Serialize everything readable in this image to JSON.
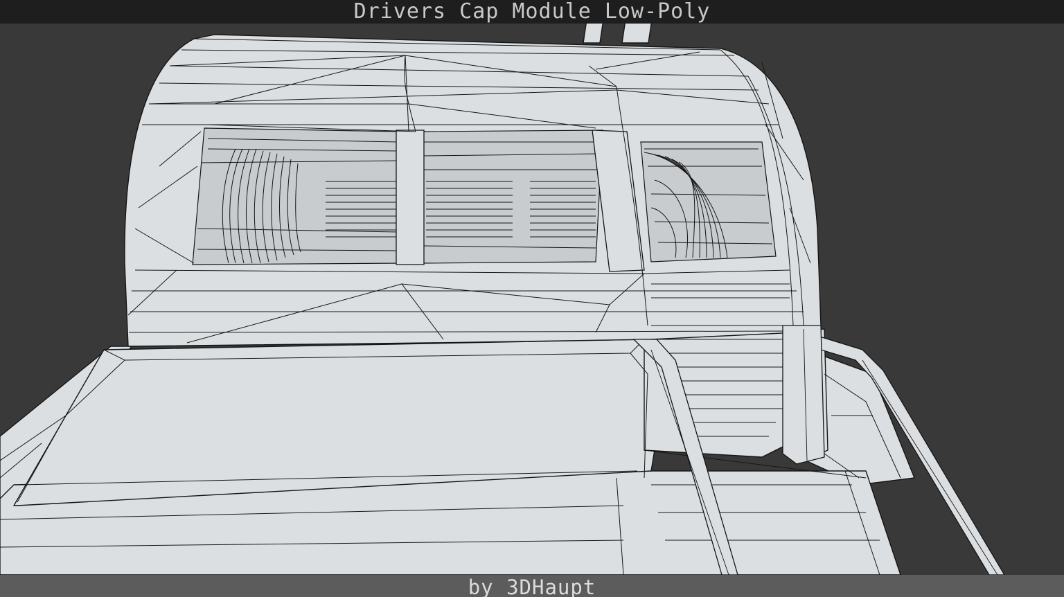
{
  "viewer": {
    "title": "Drivers Cap Module Low-Poly",
    "credit": "by 3DHaupt"
  },
  "colors": {
    "background": "#393939",
    "title_bar": "#1e1e1e",
    "credit_bar": "#5f5f5f",
    "model_fill": "#dcdfe1",
    "wire": "#151515"
  }
}
